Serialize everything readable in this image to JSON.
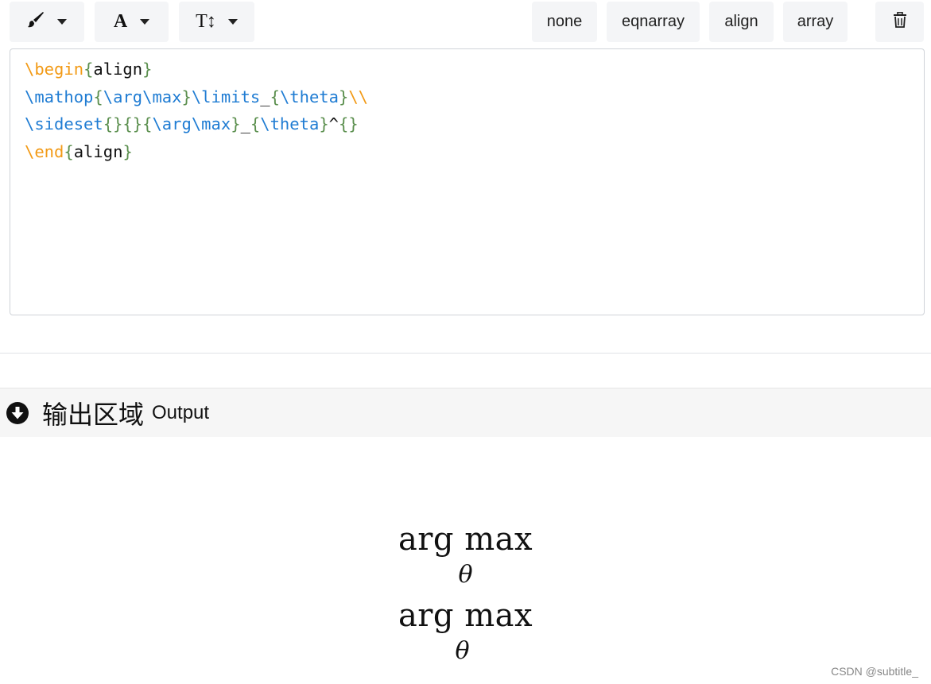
{
  "toolbar": {
    "color_icon": "paintbrush-icon",
    "font_glyph": "A",
    "size_glyph": "T↕",
    "env_buttons": [
      "none",
      "eqnarray",
      "align",
      "array"
    ],
    "delete_icon": "trash-icon"
  },
  "editor": {
    "lines": [
      [
        {
          "t": "\\begin",
          "c": "kw"
        },
        {
          "t": "{",
          "c": "br"
        },
        {
          "t": "align",
          "c": "tx"
        },
        {
          "t": "}",
          "c": "br"
        }
      ],
      [
        {
          "t": "\\mathop",
          "c": "cmd"
        },
        {
          "t": "{",
          "c": "br"
        },
        {
          "t": "\\arg\\max",
          "c": "cmd"
        },
        {
          "t": "}",
          "c": "br"
        },
        {
          "t": "\\limits",
          "c": "cmd"
        },
        {
          "t": "_",
          "c": "tx"
        },
        {
          "t": "{",
          "c": "br"
        },
        {
          "t": "\\theta",
          "c": "cmd"
        },
        {
          "t": "}",
          "c": "br"
        },
        {
          "t": "\\\\",
          "c": "kw"
        }
      ],
      [
        {
          "t": "\\sideset",
          "c": "cmd"
        },
        {
          "t": "{}{}{",
          "c": "br"
        },
        {
          "t": "\\arg\\max",
          "c": "cmd"
        },
        {
          "t": "}",
          "c": "br"
        },
        {
          "t": "_",
          "c": "tx"
        },
        {
          "t": "{",
          "c": "br"
        },
        {
          "t": "\\theta",
          "c": "cmd"
        },
        {
          "t": "}",
          "c": "br"
        },
        {
          "t": "^",
          "c": "tx"
        },
        {
          "t": "{}",
          "c": "br"
        }
      ],
      [
        {
          "t": "\\end",
          "c": "kw"
        },
        {
          "t": "{",
          "c": "br"
        },
        {
          "t": "align",
          "c": "tx"
        },
        {
          "t": "}",
          "c": "br"
        }
      ]
    ]
  },
  "output": {
    "icon": "arrow-circle-down-icon",
    "title_cn": "输出区域",
    "title_en": "Output",
    "equations": [
      {
        "operator": "arg max",
        "subscript": "θ"
      },
      {
        "operator": "arg max",
        "subscript": "θ"
      }
    ]
  },
  "watermark": "CSDN @subtitle_",
  "colors": {
    "keyword": "#f29a16",
    "command": "#1f7cd3",
    "brace": "#5b8f4e",
    "button_bg": "#f4f5f7",
    "output_header_bg": "#f6f6f6"
  }
}
